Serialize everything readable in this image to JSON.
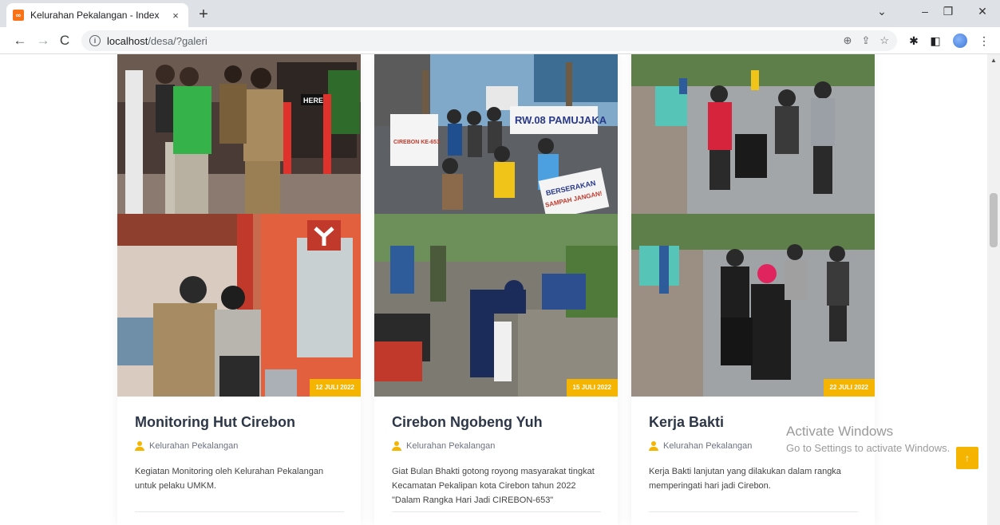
{
  "browser": {
    "tab_title": "Kelurahan Pekalangan - Index",
    "tab_close": "×",
    "new_tab": "+",
    "url_host": "localhost",
    "url_path": "/desa/?galeri",
    "info_glyph": "i",
    "icons": [
      "back-icon",
      "forward-icon",
      "reload-icon",
      "info-icon",
      "zoom-icon",
      "share-icon",
      "bookmark-star-icon",
      "extensions-icon",
      "side-panel-icon",
      "profile-avatar",
      "menu-icon"
    ]
  },
  "gallery": {
    "cards": [
      {
        "title": "Monitoring Hut Cirebon",
        "author": "Kelurahan Pekalangan",
        "date": "12 JULI 2022",
        "description": "Kegiatan Monitoring oleh Kelurahan Pekalangan untuk pelaku UMKM."
      },
      {
        "title": "Cirebon Ngobeng Yuh",
        "author": "Kelurahan Pekalangan",
        "date": "15 JULI 2022",
        "description": "Giat Bulan Bhakti gotong royong masyarakat tingkat Kecamatan Pekalipan kota Cirebon tahun 2022 \"Dalam Rangka Hari Jadi CIREBON-653\""
      },
      {
        "title": "Kerja Bakti",
        "author": "Kelurahan Pekalangan",
        "date": "22 JULI 2022",
        "description": "Kerja Bakti lanjutan yang dilakukan dalam rangka memperingati hari jadi Cirebon."
      }
    ],
    "photo_text": {
      "banner_main": "RW.08 PAMUJAKA",
      "banner_side": "CIREBON KE-653",
      "sign_a": "BERSERAKAN",
      "sign_b": "SAMPAH JANGAN!",
      "store_sign": "HERE"
    }
  },
  "overlay": {
    "watermark_title": "Activate Windows",
    "watermark_sub": "Go to Settings to activate Windows.",
    "back_to_top": "↑"
  },
  "colors": {
    "accent": "#f5b400",
    "title": "#2d3748",
    "chrome_bg": "#dee1e6"
  }
}
